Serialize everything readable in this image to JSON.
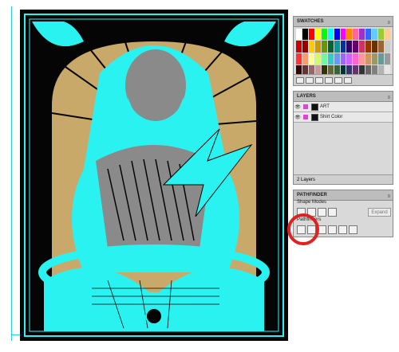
{
  "panels": {
    "swatches": {
      "title": "SWATCHES"
    },
    "layers": {
      "title": "LAYERS",
      "rows": [
        {
          "name": "ART",
          "color": "#e044d0"
        },
        {
          "name": "Shirt Color",
          "color": "#e044d0"
        }
      ],
      "footer": "2 Layers"
    },
    "pathfinder": {
      "title": "PATHFINDER",
      "shape_modes_label": "Shape Modes",
      "pathfinders_label": "Pathfinders",
      "expand_label": "Expand"
    }
  },
  "colors": {
    "artwork_cyan": "#2af2f0",
    "artwork_tan": "#c9a96a",
    "artwork_black": "#050505",
    "highlight_red": "#e0211f"
  },
  "swatch_colors": [
    "#ffffff",
    "#000000",
    "#ff0000",
    "#ffff00",
    "#00ff00",
    "#00ffff",
    "#0000ff",
    "#ff00ff",
    "#ff8800",
    "#ff6699",
    "#9933cc",
    "#3366ff",
    "#66ccff",
    "#99cc33",
    "#ffcc99",
    "#cc0000",
    "#990000",
    "#ffcc00",
    "#cc9900",
    "#669900",
    "#006633",
    "#009999",
    "#003399",
    "#330066",
    "#660066",
    "#cc3366",
    "#993300",
    "#663300",
    "#996633",
    "#cccccc",
    "#ff3333",
    "#ff9966",
    "#ffff99",
    "#ccff66",
    "#66ff99",
    "#33cccc",
    "#6699ff",
    "#9966ff",
    "#cc66ff",
    "#ff66cc",
    "#ff9999",
    "#cc9966",
    "#999966",
    "#669999",
    "#999999",
    "#330000",
    "#663333",
    "#996666",
    "#cc9999",
    "#333300",
    "#666633",
    "#336633",
    "#003333",
    "#333366",
    "#663366",
    "#333333",
    "#666666",
    "#808080",
    "#b3b3b3",
    "#e6e6e6"
  ]
}
